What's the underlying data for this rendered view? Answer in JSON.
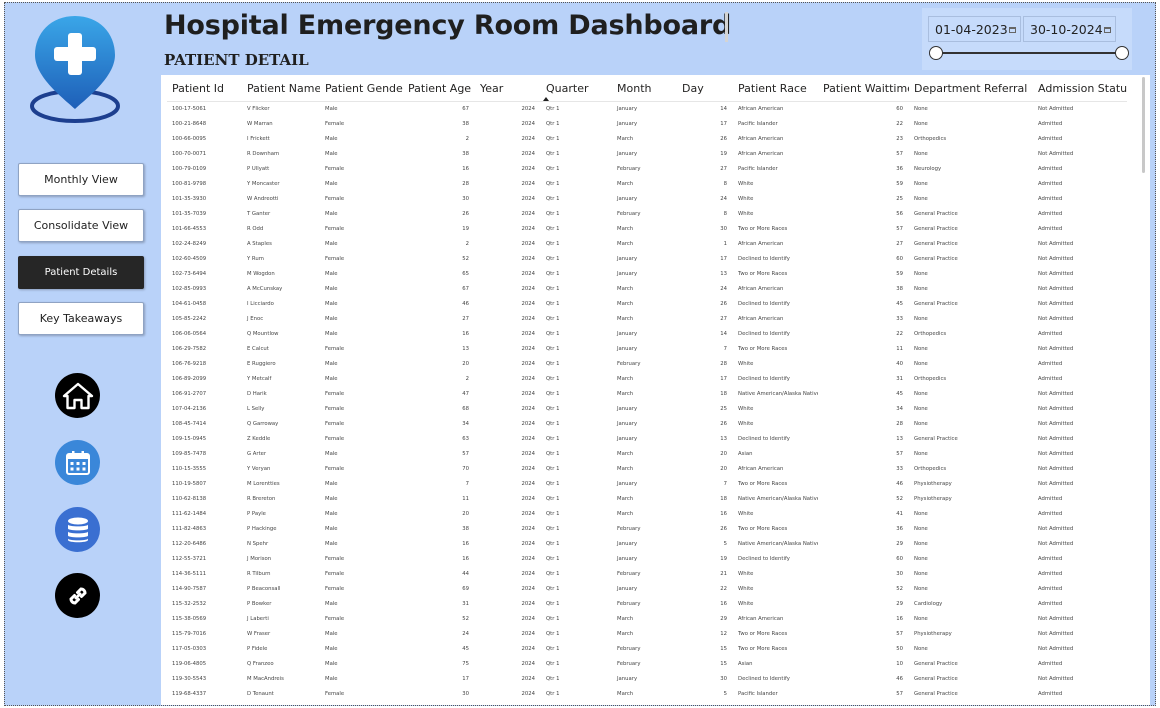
{
  "header": {
    "title": "Hospital Emergency Room Dashboard",
    "subtitle": "PATIENT DETAIL"
  },
  "slicer": {
    "start_date": "01-04-2023",
    "end_date": "30-10-2024",
    "range_fraction": [
      0,
      1
    ]
  },
  "sidebar": {
    "buttons": [
      {
        "label": "Monthly View",
        "active": false
      },
      {
        "label": "Consolidate View",
        "active": false
      },
      {
        "label": "Patient Details",
        "active": true
      },
      {
        "label": "Key Takeaways",
        "active": false
      }
    ],
    "icons": [
      "home-icon",
      "calendar-icon",
      "database-icon",
      "link-icon"
    ]
  },
  "colors": {
    "background": "#b9d2f9",
    "active_button": "#262626",
    "icon_blue": "#3a87d9",
    "icon_dark": "#000000"
  },
  "table": {
    "sorted_column": "Quarter",
    "columns": [
      "Patient Id",
      "Patient Name",
      "Patient Gender",
      "Patient Age",
      "Year",
      "Quarter",
      "Month",
      "Day",
      "Patient Race",
      "Patient Waittime",
      "Department Referral",
      "Admission Status"
    ],
    "rows": [
      [
        "100-17-5061",
        "V Flicker",
        "Male",
        "67",
        "2024",
        "Qtr 1",
        "January",
        "14",
        "African American",
        "60",
        "None",
        "Not Admitted"
      ],
      [
        "100-21-8648",
        "W Marran",
        "Female",
        "38",
        "2024",
        "Qtr 1",
        "January",
        "17",
        "Pacific Islander",
        "22",
        "None",
        "Admitted"
      ],
      [
        "100-66-0095",
        "I Frickett",
        "Male",
        "2",
        "2024",
        "Qtr 1",
        "March",
        "26",
        "African American",
        "23",
        "Orthopedics",
        "Admitted"
      ],
      [
        "100-70-0071",
        "R Downham",
        "Male",
        "38",
        "2024",
        "Qtr 1",
        "January",
        "19",
        "African American",
        "57",
        "None",
        "Not Admitted"
      ],
      [
        "100-79-0109",
        "P Ullyatt",
        "Female",
        "16",
        "2024",
        "Qtr 1",
        "February",
        "27",
        "Pacific Islander",
        "36",
        "Neurology",
        "Admitted"
      ],
      [
        "100-81-9798",
        "Y Moncaster",
        "Male",
        "28",
        "2024",
        "Qtr 1",
        "March",
        "8",
        "White",
        "59",
        "None",
        "Admitted"
      ],
      [
        "101-35-3930",
        "W Andreotti",
        "Female",
        "30",
        "2024",
        "Qtr 1",
        "January",
        "24",
        "White",
        "25",
        "None",
        "Admitted"
      ],
      [
        "101-35-7039",
        "T Ganter",
        "Male",
        "26",
        "2024",
        "Qtr 1",
        "February",
        "8",
        "White",
        "56",
        "General Practice",
        "Admitted"
      ],
      [
        "101-66-4553",
        "R Odd",
        "Female",
        "19",
        "2024",
        "Qtr 1",
        "March",
        "30",
        "Two or More Races",
        "57",
        "General Practice",
        "Admitted"
      ],
      [
        "102-24-8249",
        "A Staples",
        "Male",
        "2",
        "2024",
        "Qtr 1",
        "March",
        "1",
        "African American",
        "27",
        "General Practice",
        "Not Admitted"
      ],
      [
        "102-60-4509",
        "Y Rum",
        "Female",
        "52",
        "2024",
        "Qtr 1",
        "January",
        "17",
        "Declined to Identify",
        "60",
        "General Practice",
        "Not Admitted"
      ],
      [
        "102-73-6494",
        "M Wogdon",
        "Male",
        "65",
        "2024",
        "Qtr 1",
        "January",
        "13",
        "Two or More Races",
        "59",
        "None",
        "Not Admitted"
      ],
      [
        "102-85-0993",
        "A McCunskay",
        "Male",
        "67",
        "2024",
        "Qtr 1",
        "March",
        "24",
        "African American",
        "38",
        "None",
        "Not Admitted"
      ],
      [
        "104-61-0458",
        "I Licciardo",
        "Male",
        "46",
        "2024",
        "Qtr 1",
        "March",
        "26",
        "Declined to Identify",
        "45",
        "General Practice",
        "Not Admitted"
      ],
      [
        "105-85-2242",
        "J Enoc",
        "Male",
        "27",
        "2024",
        "Qtr 1",
        "March",
        "27",
        "African American",
        "33",
        "None",
        "Not Admitted"
      ],
      [
        "106-06-0564",
        "Q Mountlow",
        "Male",
        "16",
        "2024",
        "Qtr 1",
        "January",
        "14",
        "Declined to Identify",
        "22",
        "Orthopedics",
        "Admitted"
      ],
      [
        "106-29-7582",
        "E Calcut",
        "Female",
        "13",
        "2024",
        "Qtr 1",
        "January",
        "7",
        "Two or More Races",
        "11",
        "None",
        "Not Admitted"
      ],
      [
        "106-76-9218",
        "E Ruggiero",
        "Male",
        "20",
        "2024",
        "Qtr 1",
        "February",
        "28",
        "White",
        "40",
        "None",
        "Admitted"
      ],
      [
        "106-89-2099",
        "Y Metcalf",
        "Male",
        "2",
        "2024",
        "Qtr 1",
        "March",
        "17",
        "Declined to Identify",
        "31",
        "Orthopedics",
        "Admitted"
      ],
      [
        "106-91-2707",
        "D Harik",
        "Female",
        "47",
        "2024",
        "Qtr 1",
        "March",
        "18",
        "Native American/Alaska Native",
        "45",
        "None",
        "Not Admitted"
      ],
      [
        "107-04-2136",
        "L Selly",
        "Female",
        "68",
        "2024",
        "Qtr 1",
        "January",
        "25",
        "White",
        "34",
        "None",
        "Not Admitted"
      ],
      [
        "108-45-7414",
        "Q Garroway",
        "Female",
        "34",
        "2024",
        "Qtr 1",
        "January",
        "26",
        "White",
        "28",
        "None",
        "Not Admitted"
      ],
      [
        "109-15-0945",
        "Z Keddle",
        "Female",
        "63",
        "2024",
        "Qtr 1",
        "January",
        "13",
        "Declined to Identify",
        "13",
        "General Practice",
        "Not Admitted"
      ],
      [
        "109-85-7478",
        "G Arter",
        "Male",
        "57",
        "2024",
        "Qtr 1",
        "March",
        "20",
        "Asian",
        "57",
        "None",
        "Not Admitted"
      ],
      [
        "110-15-3555",
        "Y Veryan",
        "Female",
        "70",
        "2024",
        "Qtr 1",
        "March",
        "20",
        "African American",
        "33",
        "Orthopedics",
        "Not Admitted"
      ],
      [
        "110-19-5807",
        "M Lorentties",
        "Male",
        "7",
        "2024",
        "Qtr 1",
        "January",
        "7",
        "Two or More Races",
        "46",
        "Physiotherapy",
        "Not Admitted"
      ],
      [
        "110-62-8138",
        "R Brereton",
        "Male",
        "11",
        "2024",
        "Qtr 1",
        "March",
        "18",
        "Native American/Alaska Native",
        "52",
        "Physiotherapy",
        "Admitted"
      ],
      [
        "111-62-1484",
        "P Payle",
        "Male",
        "20",
        "2024",
        "Qtr 1",
        "March",
        "16",
        "White",
        "41",
        "None",
        "Admitted"
      ],
      [
        "111-82-4863",
        "P Hackinge",
        "Male",
        "38",
        "2024",
        "Qtr 1",
        "February",
        "26",
        "Two or More Races",
        "36",
        "None",
        "Not Admitted"
      ],
      [
        "112-20-6486",
        "N Spehr",
        "Male",
        "16",
        "2024",
        "Qtr 1",
        "January",
        "5",
        "Native American/Alaska Native",
        "29",
        "None",
        "Not Admitted"
      ],
      [
        "112-55-3721",
        "J Morison",
        "Female",
        "16",
        "2024",
        "Qtr 1",
        "January",
        "19",
        "Declined to Identify",
        "60",
        "None",
        "Admitted"
      ],
      [
        "114-36-5111",
        "R Tilburn",
        "Female",
        "44",
        "2024",
        "Qtr 1",
        "February",
        "21",
        "White",
        "30",
        "None",
        "Admitted"
      ],
      [
        "114-90-7587",
        "P Beaconsall",
        "Female",
        "69",
        "2024",
        "Qtr 1",
        "January",
        "22",
        "White",
        "52",
        "None",
        "Admitted"
      ],
      [
        "115-32-2532",
        "P Bowker",
        "Male",
        "31",
        "2024",
        "Qtr 1",
        "February",
        "16",
        "White",
        "29",
        "Cardiology",
        "Admitted"
      ],
      [
        "115-38-0569",
        "J Laberti",
        "Female",
        "52",
        "2024",
        "Qtr 1",
        "March",
        "29",
        "African American",
        "16",
        "None",
        "Not Admitted"
      ],
      [
        "115-79-7016",
        "W Fraser",
        "Male",
        "24",
        "2024",
        "Qtr 1",
        "March",
        "12",
        "Two or More Races",
        "57",
        "Physiotherapy",
        "Not Admitted"
      ],
      [
        "117-05-0303",
        "P Fidele",
        "Male",
        "45",
        "2024",
        "Qtr 1",
        "February",
        "15",
        "Two or More Races",
        "50",
        "None",
        "Not Admitted"
      ],
      [
        "119-06-4805",
        "Q Franzeo",
        "Male",
        "75",
        "2024",
        "Qtr 1",
        "February",
        "15",
        "Asian",
        "10",
        "General Practice",
        "Admitted"
      ],
      [
        "119-30-5543",
        "M MacAndreis",
        "Male",
        "17",
        "2024",
        "Qtr 1",
        "January",
        "30",
        "Declined to Identify",
        "46",
        "General Practice",
        "Not Admitted"
      ],
      [
        "119-68-4337",
        "D Tenaunt",
        "Female",
        "30",
        "2024",
        "Qtr 1",
        "March",
        "5",
        "Pacific Islander",
        "57",
        "General Practice",
        "Admitted"
      ]
    ]
  }
}
